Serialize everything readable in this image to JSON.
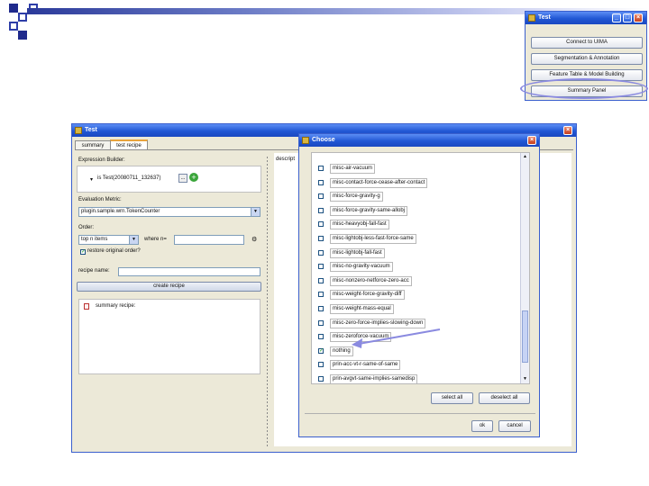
{
  "colors": {
    "accent": "#2157d4",
    "annotation": "#8a8ae0",
    "slide_blue": "#1f2a8c"
  },
  "mini_window": {
    "title": "Test",
    "buttons": [
      "Connect to UIMA",
      "Segmentation & Annotation",
      "Feature Table & Model Building",
      "Summary Panel"
    ],
    "highlighted": "Summary Panel"
  },
  "main_window": {
    "title": "Test",
    "tabs": [
      "summary",
      "test recipe"
    ],
    "active_tab": "test recipe",
    "expression_builder_label": "Expression Builder:",
    "expression_value": "is Test(20080711_132637)",
    "expression_more": "...",
    "evaluation_metric_label": "Evaluation Metric:",
    "evaluation_metric_value": "plugin.sample.wrn.TokenCounter",
    "order_label": "Order:",
    "order_value": "top n items",
    "where_label": "where n=",
    "restore_label": "restore original order?",
    "restore_checked": true,
    "recipe_name_label": "recipe name:",
    "create_button": "create recipe",
    "summary_recipe_label": "summary recipe:",
    "right_pane_header": "descript"
  },
  "choose_dialog": {
    "title": "Choose",
    "items": [
      {
        "label": "misc-air-vacuum",
        "checked": false
      },
      {
        "label": "misc-contact-force-cease-after-contact",
        "checked": false
      },
      {
        "label": "misc-force-gravity-g",
        "checked": false
      },
      {
        "label": "misc-force-gravity-same-allobj",
        "checked": false
      },
      {
        "label": "misc-heavyobj-fall-fast",
        "checked": false
      },
      {
        "label": "misc-lightobj-less-fast-force-same",
        "checked": false
      },
      {
        "label": "misc-lightobj-fall-fast",
        "checked": false
      },
      {
        "label": "misc-no-gravity-vacuum",
        "checked": false
      },
      {
        "label": "misc-nonzero-netforce-zero-acc",
        "checked": false
      },
      {
        "label": "misc-weight-force-gravity-diff",
        "checked": false
      },
      {
        "label": "misc-weight-mass-equal",
        "checked": false
      },
      {
        "label": "misc-zero-force-implies-slowing-down",
        "checked": false
      },
      {
        "label": "misc-zeroforce-vacuum",
        "checked": false
      },
      {
        "label": "nothing",
        "checked": true
      },
      {
        "label": "prin-acc-vt-r-same-of-same",
        "checked": false
      },
      {
        "label": "prin-avgvt-same-implies-samedisp",
        "checked": false
      }
    ],
    "select_all": "select all",
    "deselect_all": "deselect all",
    "ok": "ok",
    "cancel": "cancel"
  }
}
